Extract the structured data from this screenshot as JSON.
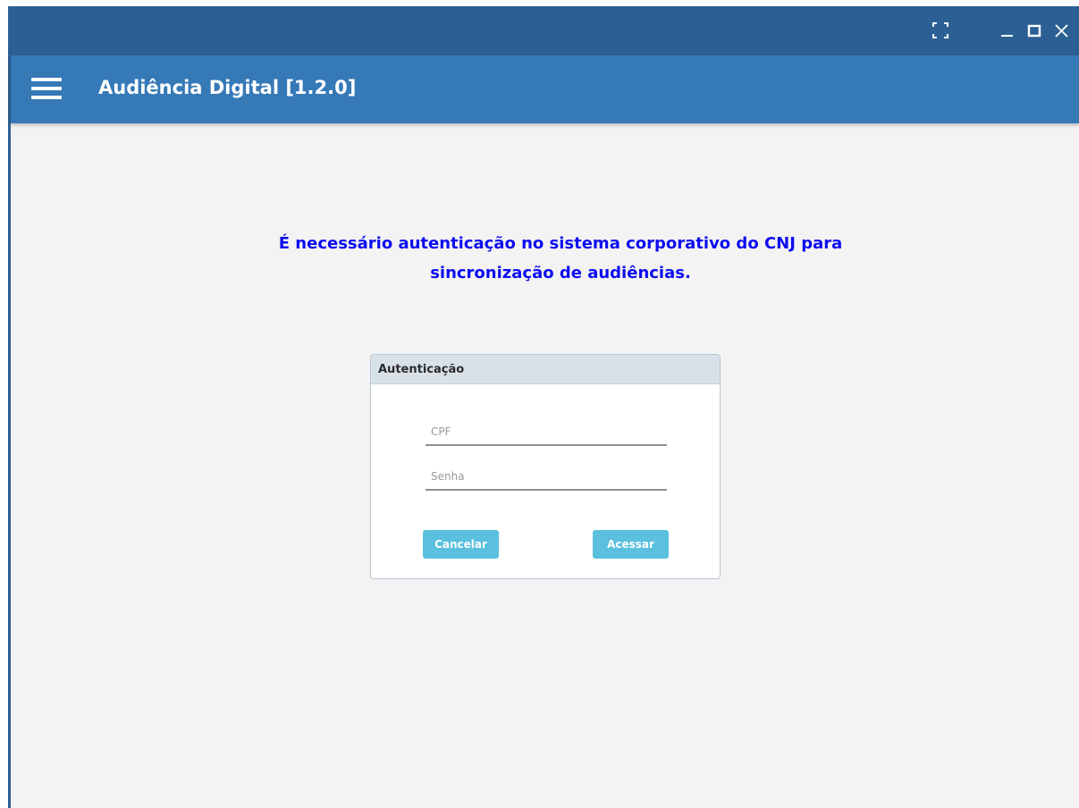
{
  "window": {
    "controls": {
      "fullscreen_icon": "fullscreen-icon",
      "minimize_icon": "minimize-icon",
      "maximize_icon": "maximize-icon",
      "close_icon": "close-icon"
    }
  },
  "appbar": {
    "menu_icon": "hamburger-menu-icon",
    "title": "Audiência Digital [1.2.0]"
  },
  "main": {
    "message_line1": "É necessário autenticação no sistema corporativo do CNJ para",
    "message_line2": "sincronização de audiências."
  },
  "auth": {
    "header": "Autenticação",
    "cpf": {
      "value": "",
      "placeholder": "CPF"
    },
    "senha": {
      "value": "",
      "placeholder": "Senha"
    },
    "cancel_label": "Cancelar",
    "submit_label": "Acessar"
  },
  "colors": {
    "titlebar": "#2c6094",
    "appbar": "#3579b7",
    "message_text": "#0c0cf0",
    "button": "#5bc0de",
    "card_header": "#d8e0e8",
    "background": "#f3f3f3"
  }
}
